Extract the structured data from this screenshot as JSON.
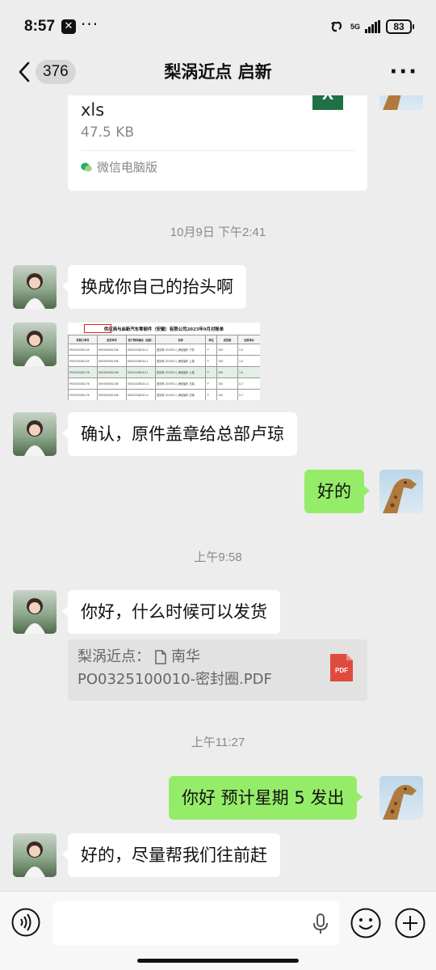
{
  "status_bar": {
    "time": "8:57",
    "icons": [
      "x-app-icon",
      "more-dots-icon",
      "link-icon",
      "signal-icon",
      "battery-icon"
    ],
    "network": "5G",
    "battery": "83"
  },
  "header": {
    "unread_count": "376",
    "title": "梨涡近点 启新"
  },
  "messages": {
    "file": {
      "name_line": "xls",
      "size": "47.5 KB",
      "badge": "X",
      "source": "微信电脑版"
    },
    "ts1": "10月9日 下午2:41",
    "msg1": "换成你自己的抬头啊",
    "image": {
      "title": "供应商与启新汽车零部件（安徽）有限公司2025年9月对账单",
      "headers": [
        "采购订单号",
        "送货单号",
        "客户物料编码（启新）",
        "名称",
        "单位",
        "送货数",
        "含税单价"
      ],
      "rows": [
        [
          "PO0325081145",
          "SH0925081206",
          "K502032B010-1",
          "密封条-21K3511_海尼福车 下前",
          "个",
          "100",
          "2.0"
        ],
        [
          "PO0325081145",
          "SH0925081206",
          "K502032B010-1",
          "密封条-21K3511_海尼福车 上端",
          "个",
          "100",
          "1.0"
        ],
        [
          "PO0325081176",
          "SH0925081206",
          "K502032B010-1",
          "密封条-21K3511_海尼福车 上端",
          "个",
          "200",
          "1.0"
        ],
        [
          "PO0325081176",
          "SH0925081206",
          "K502032B010-4",
          "密封条-21K3511_海尼福车 左端",
          "个",
          "100",
          "0.7"
        ],
        [
          "PO0325081176",
          "SH0925081206",
          "K502032B010-4",
          "密封条-21K3511_海尼福车 右端",
          "个",
          "100",
          "0.7"
        ]
      ]
    },
    "msg2": "确认，原件盖章给总部卢琼",
    "reply1": "好的",
    "ts2": "上午9:58",
    "msg3": "你好，什么时候可以发货",
    "quote": {
      "sender": "梨涡近点：",
      "file_name": "南华",
      "file_line2": "PO0325100010-密封圈.PDF",
      "badge": "PDF"
    },
    "ts3": "上午11:27",
    "reply2": "你好 预计星期 5 发出",
    "msg4": "好的，尽量帮我们往前赶"
  },
  "colors": {
    "background": "#ededed",
    "bubble_self": "#95ec69",
    "bubble_other": "#ffffff",
    "xls": "#1e7145",
    "pdf": "#e04b3f"
  }
}
